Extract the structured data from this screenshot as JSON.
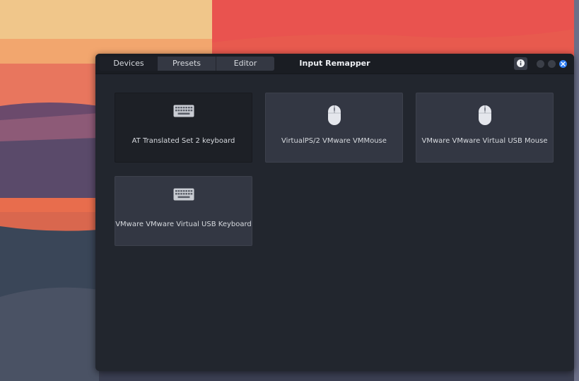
{
  "window": {
    "title": "Input Remapper"
  },
  "tabs": [
    {
      "label": "Devices"
    },
    {
      "label": "Presets"
    },
    {
      "label": "Editor"
    }
  ],
  "devices": [
    {
      "label": "AT Translated Set 2 keyboard",
      "icon": "keyboard-icon",
      "selected": true
    },
    {
      "label": "VirtualPS/2 VMware VMMouse",
      "icon": "mouse-icon",
      "selected": false
    },
    {
      "label": "VMware VMware Virtual USB Mouse",
      "icon": "mouse-icon",
      "selected": false
    },
    {
      "label": "VMware VMware Virtual USB Keyboard",
      "icon": "keyboard-icon",
      "selected": false
    }
  ],
  "colors": {
    "window_bg": "#22262e",
    "card_bg": "#333743",
    "card_selected_bg": "#1d2026",
    "close_accent": "#2f7ef5"
  }
}
